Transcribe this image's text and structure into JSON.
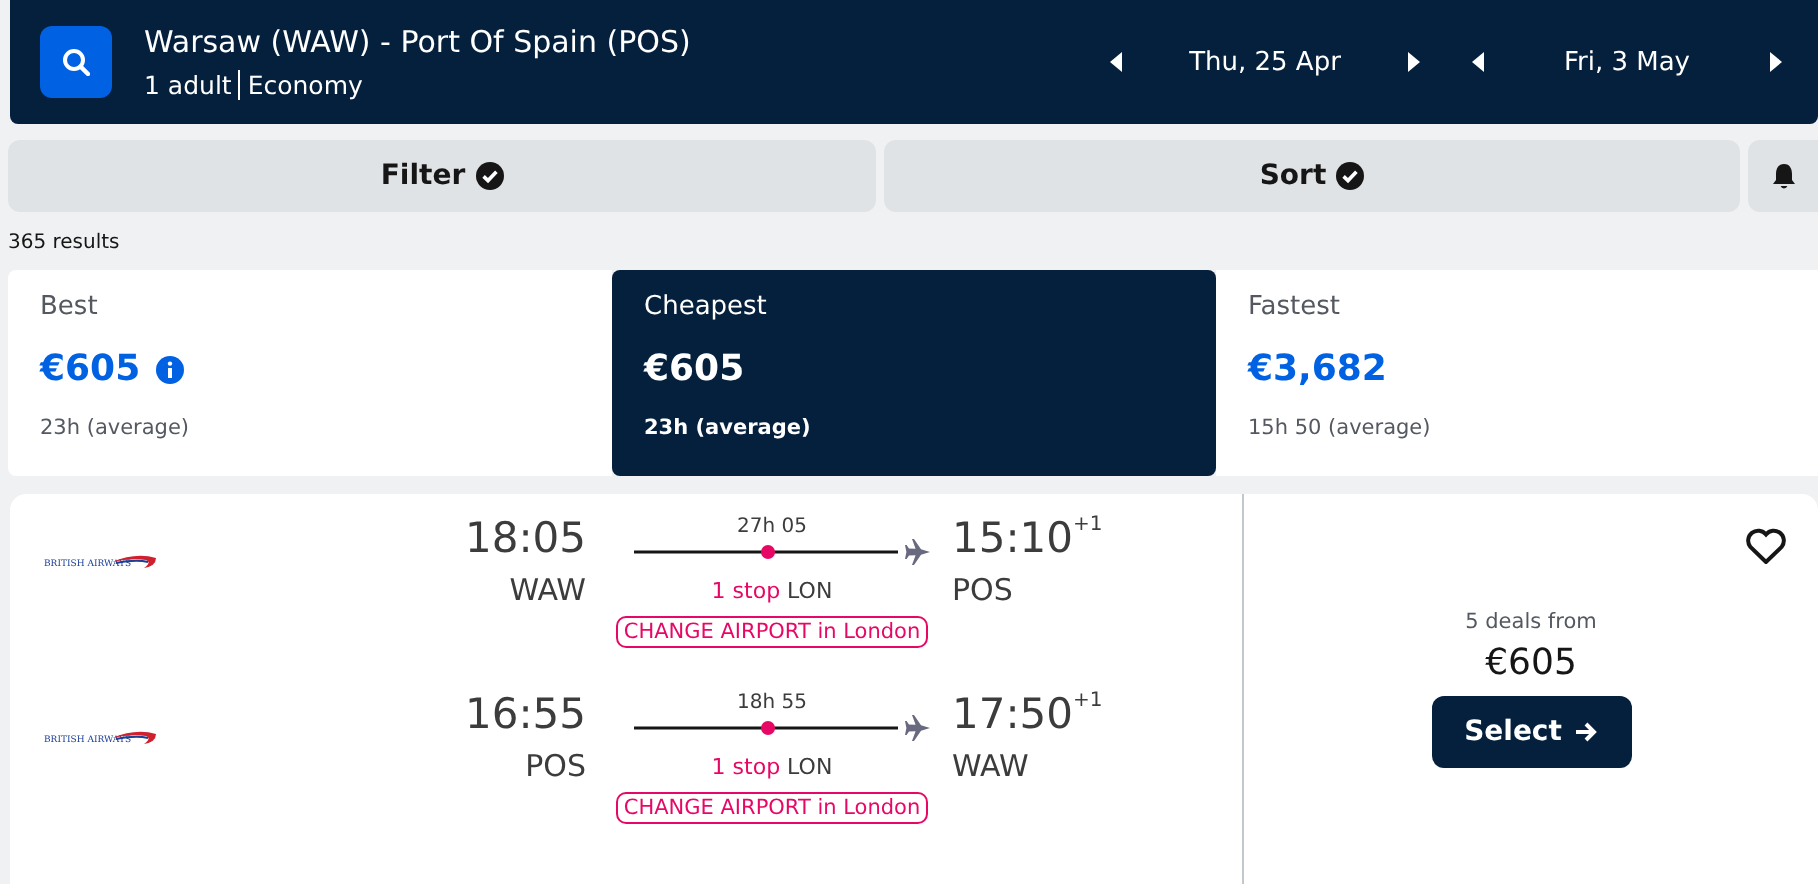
{
  "search": {
    "route": "Warsaw (WAW) - Port Of Spain (POS)",
    "passengers": "1 adult",
    "cabin": "Economy",
    "dates": [
      {
        "label": "Thu, 25 Apr"
      },
      {
        "label": "Fri, 3 May"
      }
    ]
  },
  "toolbar": {
    "buttons": [
      {
        "label": "Filter",
        "applied": true
      },
      {
        "label": "Sort",
        "applied": true
      }
    ]
  },
  "results_count": "365 results",
  "sort_tabs": [
    {
      "label": "Best",
      "price": "€605",
      "duration": "23h (average)",
      "info": true,
      "selected": false
    },
    {
      "label": "Cheapest",
      "price": "€605",
      "duration": "23h (average)",
      "info": false,
      "selected": true
    },
    {
      "label": "Fastest",
      "price": "€3,682",
      "duration": "15h 50 (average)",
      "info": false,
      "selected": false
    }
  ],
  "flight": {
    "legs": [
      {
        "airline": "BRITISH AIRWAYS",
        "depart_time": "18:05",
        "depart_airport": "WAW",
        "duration": "27h 05",
        "stops": "1 stop",
        "stop_airport": "LON",
        "arrive_time": "15:10",
        "day_offset": "+1",
        "arrive_airport": "POS",
        "notice": "CHANGE AIRPORT in London"
      },
      {
        "airline": "BRITISH AIRWAYS",
        "depart_time": "16:55",
        "depart_airport": "POS",
        "duration": "18h 55",
        "stops": "1 stop",
        "stop_airport": "LON",
        "arrive_time": "17:50",
        "day_offset": "+1",
        "arrive_airport": "WAW",
        "notice": "CHANGE AIRPORT in London"
      }
    ],
    "favourite": false,
    "deals": "5 deals from",
    "price": "€605",
    "select_label": "Select"
  }
}
